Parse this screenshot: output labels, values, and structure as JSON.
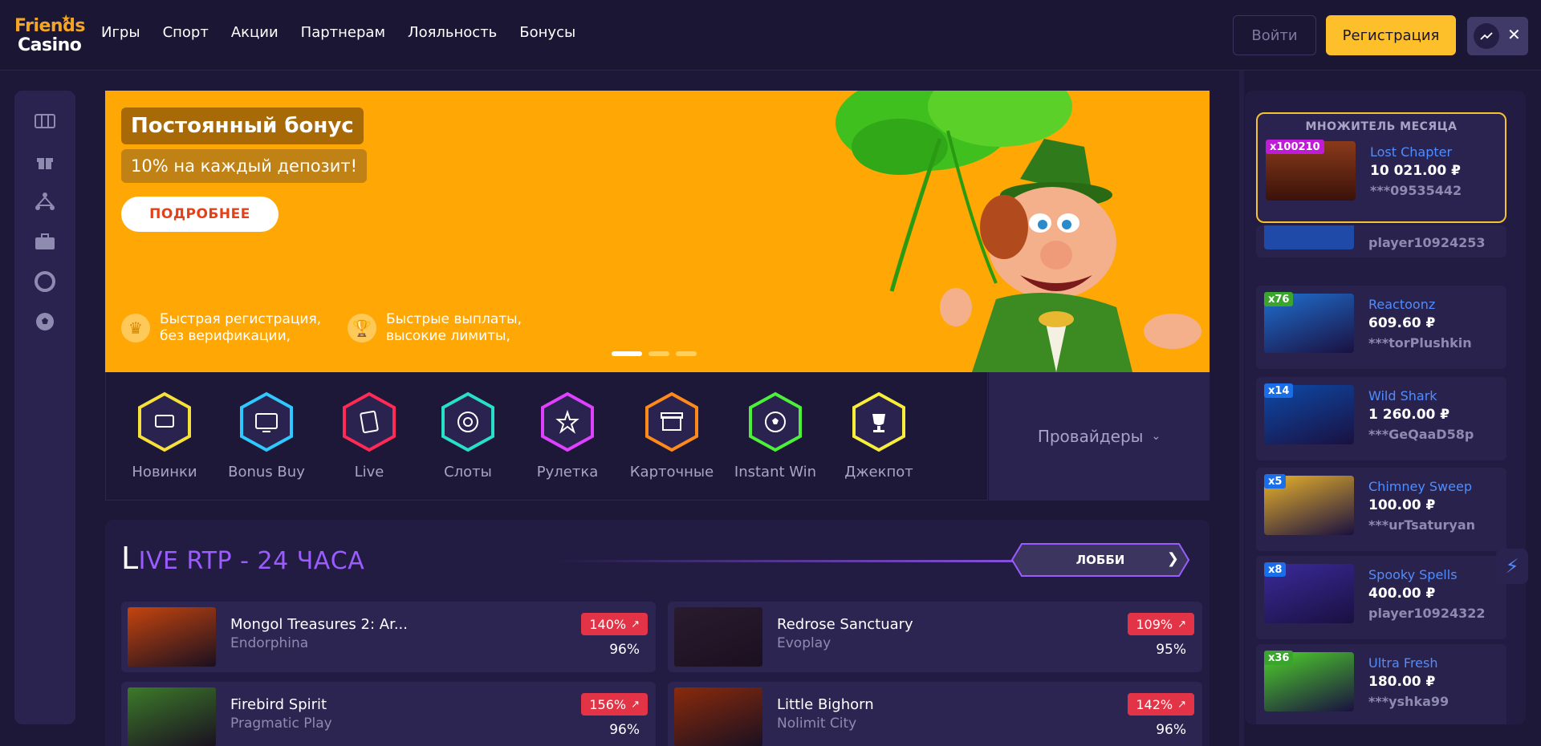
{
  "header": {
    "logo_line1": "Friends",
    "logo_line2": "Casino",
    "nav": [
      "Игры",
      "Спорт",
      "Акции",
      "Партнерам",
      "Лояльность",
      "Бонусы"
    ],
    "login_label": "Войти",
    "register_label": "Регистрация"
  },
  "colors": {
    "background": "#1d1838",
    "accent_yellow": "#fdc02a",
    "banner_orange": "#ffa704",
    "purple": "#9b5cff",
    "link_blue": "#4f8dff",
    "badge_red": "#e33346"
  },
  "sidebar": {
    "icons": [
      "slots-icon",
      "gift-icon",
      "tournament-icon",
      "briefcase-icon",
      "lifebuoy-icon",
      "football-icon"
    ]
  },
  "banner": {
    "title": "Постоянный бонус",
    "subtitle": "10% на каждый депозит!",
    "cta_label": "ПОДРОБНЕЕ",
    "features": [
      {
        "icon": "crown-icon",
        "line1": "Быстрая регистрация,",
        "line2": "без верификации,"
      },
      {
        "icon": "trophy-icon",
        "line1": "Быстрые выплаты,",
        "line2": "высокие лимиты,"
      }
    ],
    "slide_count": 3,
    "active_slide": 1
  },
  "categories": [
    {
      "label": "Новинки",
      "icon": "new-slot-icon",
      "color": "#f5e13a"
    },
    {
      "label": "Bonus Buy",
      "icon": "tv-icon",
      "color": "#2fc8ff"
    },
    {
      "label": "Live",
      "icon": "cards-icon",
      "color": "#ff2a55"
    },
    {
      "label": "Слоты",
      "icon": "chip-icon",
      "color": "#28e0c8"
    },
    {
      "label": "Рулетка",
      "icon": "star-icon",
      "color": "#e040ff"
    },
    {
      "label": "Карточные",
      "icon": "giftbox-icon",
      "color": "#ff8a1a"
    },
    {
      "label": "Instant Win",
      "icon": "ball-icon",
      "color": "#4cf03a"
    },
    {
      "label": "Джекпот",
      "icon": "cup-icon",
      "color": "#f7ee3a"
    }
  ],
  "providers_label": "Провайдеры",
  "live_rtp": {
    "title_first": "L",
    "title_rest": "IVE RTP - 24 ЧАСА",
    "lobby_label": "ЛОББИ",
    "games": [
      {
        "name": "Mongol Treasures 2: Ar...",
        "provider": "Endorphina",
        "change": "140%",
        "rtp": "96%",
        "thumb_color": "#c4440e"
      },
      {
        "name": "Redrose Sanctuary",
        "provider": "Evoplay",
        "change": "109%",
        "rtp": "95%",
        "thumb_color": "#2a1b2e"
      },
      {
        "name": "Firebird Spirit",
        "provider": "Pragmatic Play",
        "change": "156%",
        "rtp": "96%",
        "thumb_color": "#3c7a2a"
      },
      {
        "name": "Little Bighorn",
        "provider": "Nolimit City",
        "change": "142%",
        "rtp": "96%",
        "thumb_color": "#8a2a0c"
      }
    ]
  },
  "right_panel": {
    "month_header": "МНОЖИТЕЛЬ МЕСЯЦА",
    "month_win": {
      "mult": "x100210",
      "game": "Lost Chapter",
      "amount": "10 021.00 ₽",
      "user": "***09535442",
      "thumb_color": "#6a2a1a",
      "mult_color": "#c01bd8"
    },
    "partial_user": "player10924253",
    "wins": [
      {
        "mult": "x76",
        "game": "Reactoonz",
        "amount": "609.60 ₽",
        "user": "***torPlushkin",
        "thumb_color": "#1f6fd0",
        "mult_color": "#3aa52c"
      },
      {
        "mult": "x14",
        "game": "Wild Shark",
        "amount": "1 260.00 ₽",
        "user": "***GeQaaD58p",
        "thumb_color": "#0d4aa8",
        "mult_color": "#1a6ee8"
      },
      {
        "mult": "x5",
        "game": "Chimney Sweep",
        "amount": "100.00 ₽",
        "user": "***urTsaturyan",
        "thumb_color": "#e8b22a",
        "mult_color": "#1a6ee8"
      },
      {
        "mult": "x8",
        "game": "Spooky Spells",
        "amount": "400.00 ₽",
        "user": "player10924322",
        "thumb_color": "#3a2a9a",
        "mult_color": "#1a6ee8"
      },
      {
        "mult": "x36",
        "game": "Ultra Fresh",
        "amount": "180.00 ₽",
        "user": "***yshka99",
        "thumb_color": "#4ed02a",
        "mult_color": "#3aa52c"
      }
    ]
  }
}
